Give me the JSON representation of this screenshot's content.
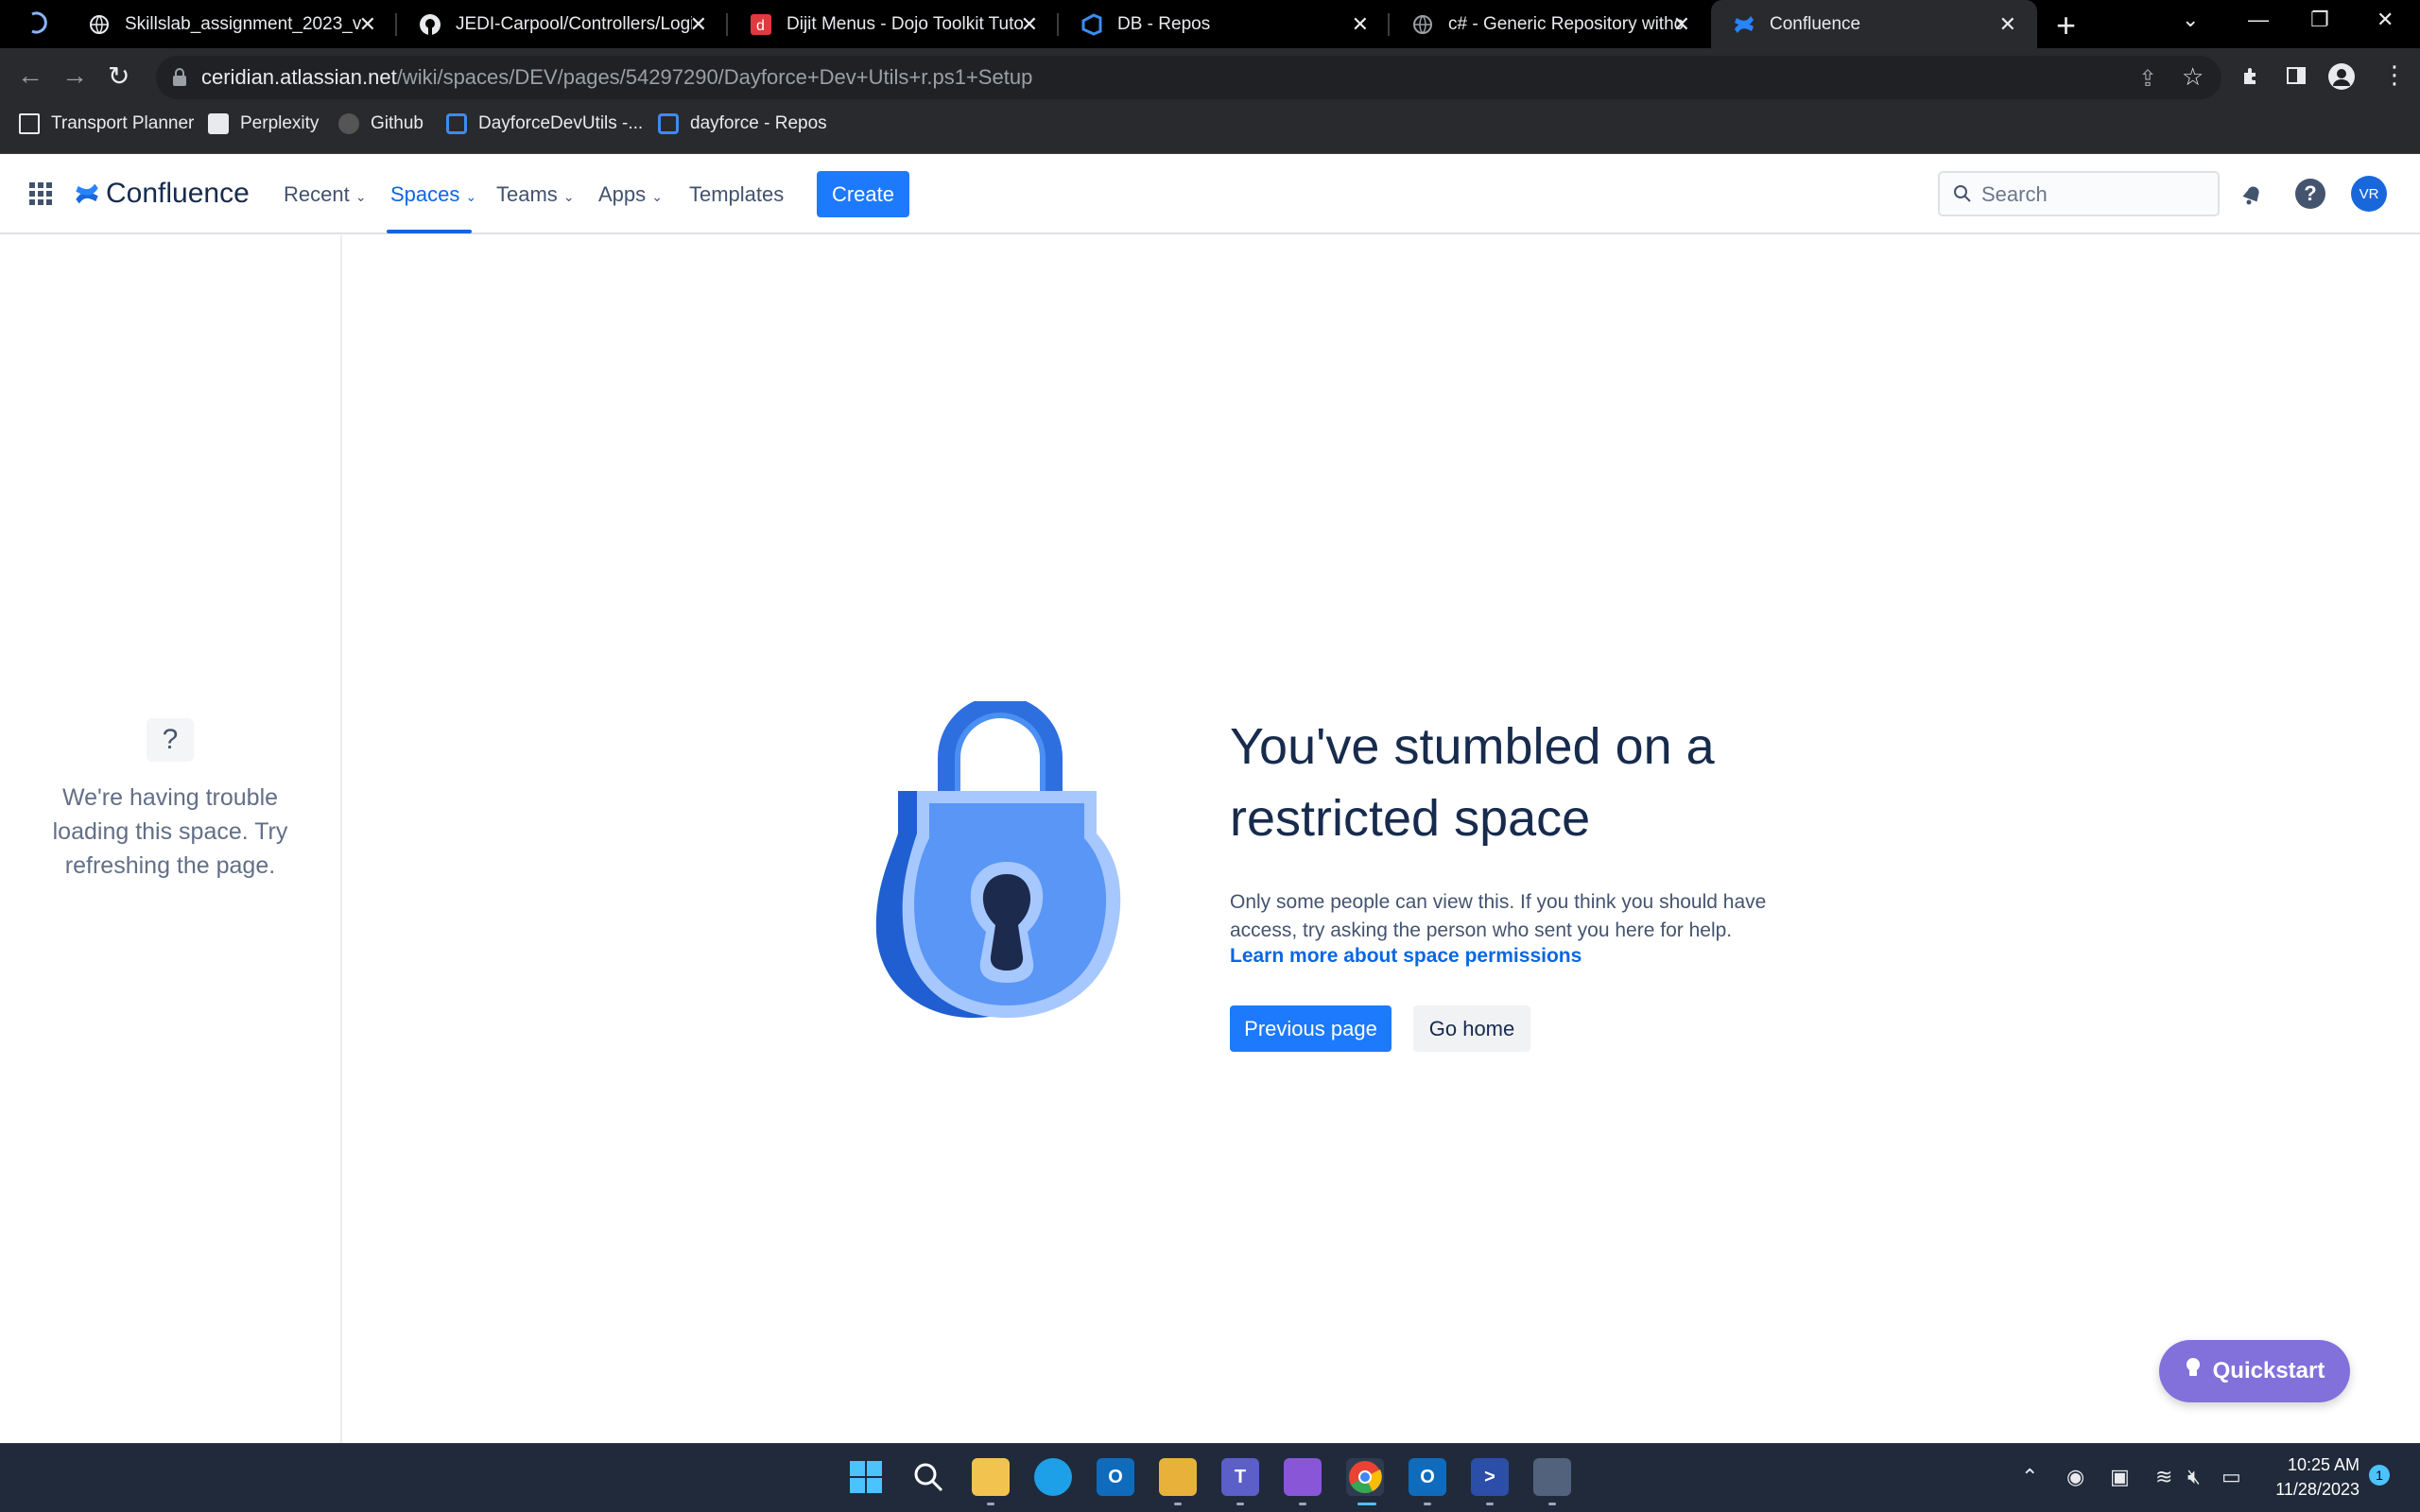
{
  "browser": {
    "tabs": [
      {
        "title": "Skillslab_assignment_2023_v1.0",
        "icon": "globe-icon"
      },
      {
        "title": "JEDI-Carpool/Controllers/Login",
        "icon": "github-icon"
      },
      {
        "title": "Dijit Menus - Dojo Toolkit Tutorial",
        "icon": "dojo-icon"
      },
      {
        "title": "DB - Repos",
        "icon": "azure-devops-icon"
      },
      {
        "title": "c# - Generic Repository without",
        "icon": "globe-icon"
      },
      {
        "title": "Confluence",
        "icon": "confluence-icon"
      }
    ],
    "url_host": "ceridian.atlassian.net",
    "url_path": "/wiki/spaces/DEV/pages/54297290/Dayforce+Dev+Utils+r.ps1+Setup",
    "bookmarks": [
      {
        "label": "Transport Planner"
      },
      {
        "label": "Perplexity"
      },
      {
        "label": "Github"
      },
      {
        "label": "DayforceDevUtils -..."
      },
      {
        "label": "dayforce - Repos"
      }
    ]
  },
  "header": {
    "product": "Confluence",
    "nav": [
      {
        "label": "Recent",
        "has_dropdown": true
      },
      {
        "label": "Spaces",
        "has_dropdown": true,
        "active": true
      },
      {
        "label": "Teams",
        "has_dropdown": true
      },
      {
        "label": "Apps",
        "has_dropdown": true
      },
      {
        "label": "Templates",
        "has_dropdown": false
      }
    ],
    "create_label": "Create",
    "search_placeholder": "Search",
    "avatar_initials": "VR"
  },
  "sidebar": {
    "icon": "?",
    "message": "We're having trouble loading this space. Try refreshing the page."
  },
  "main": {
    "heading": "You've stumbled on a restricted space",
    "description": "Only some people can view this. If you think you should have access, try asking the person who sent you here for help.",
    "link": "Learn more about space permissions",
    "primary_button": "Previous page",
    "secondary_button": "Go home"
  },
  "quickstart_label": "Quickstart",
  "taskbar": {
    "time": "10:25 AM",
    "date": "11/28/2023",
    "notification_count": "1"
  },
  "colors": {
    "brand_blue": "#1d7afc",
    "link_blue": "#0c66e4",
    "quickstart_purple": "#8270db"
  }
}
